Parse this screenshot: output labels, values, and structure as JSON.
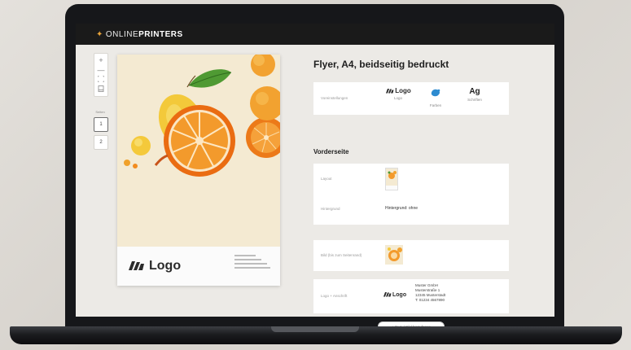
{
  "app": {
    "brand_light": "ONLINE",
    "brand_bold": "PRINTERS"
  },
  "toolbar": {
    "zoom_in_label": "+",
    "zoom_out_label": "—"
  },
  "pages": {
    "label": "Seiten",
    "items": [
      {
        "label": "1",
        "active": true
      },
      {
        "label": "2",
        "active": false
      }
    ]
  },
  "preview": {
    "logo_text": "Logo"
  },
  "product": {
    "title": "Flyer, A4, beidseitig bedruckt"
  },
  "design_card": {
    "label": "Voreinstellungen",
    "options": [
      {
        "icon": "logo-mark-icon",
        "value": "Logo",
        "caption": "Logo"
      },
      {
        "icon": "color-splash-icon",
        "value": "",
        "caption": "Farben"
      },
      {
        "icon": "font-icon",
        "value": "Ag",
        "caption": "Schriften"
      }
    ]
  },
  "front": {
    "heading": "Vorderseite",
    "layout_label": "Layout",
    "background_label": "Hintergrund",
    "background_value": "Hintergrund: ohne",
    "image_label": "Bild (bis zum Seitenrand)",
    "logo_address_label": "Logo + Anschrift",
    "logo_text": "Logo",
    "address_lines": [
      "Muster GmbH",
      "Musterstraße 1",
      "12345 Musterstadt",
      "T: 01234 4567890"
    ]
  },
  "add_button_label": "+ Text- / Bild hinzufügen",
  "colors": {
    "accent": "#e8a33a",
    "header_bg": "#1a1a1a",
    "canvas_bg": "#eceae6",
    "flyer_bg": "#f4ead2"
  }
}
